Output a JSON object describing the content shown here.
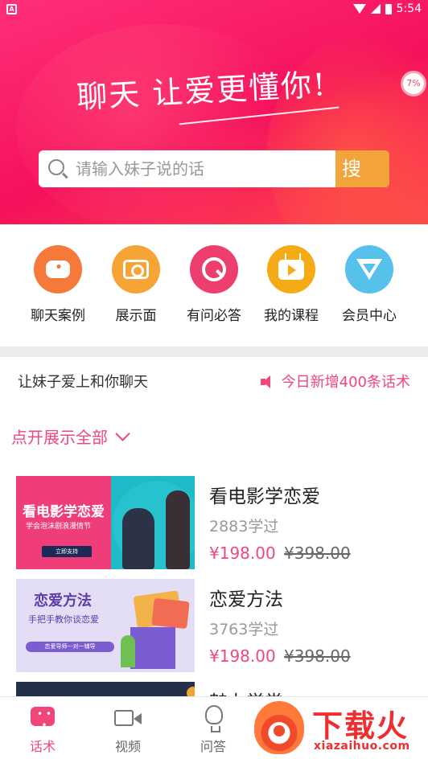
{
  "status_bar": {
    "time": "5:54",
    "app_badge": "A"
  },
  "header": {
    "slogan": "聊天  让爱更懂你!",
    "progress_badge": "7%",
    "search": {
      "placeholder": "请输入妹子说的话",
      "button_label": "搜"
    }
  },
  "colors": {
    "brand_pink": "#f0477a",
    "search_button": "#f2a43a"
  },
  "quick_nav": [
    {
      "label": "聊天案例",
      "icon": "chat-bubble-icon",
      "color": "#f57a39"
    },
    {
      "label": "展示面",
      "icon": "camera-icon",
      "color": "#f6a435"
    },
    {
      "label": "有问必答",
      "icon": "q-search-icon",
      "color": "#ee3e6e"
    },
    {
      "label": "我的课程",
      "icon": "tv-play-icon",
      "color": "#f5ab16"
    },
    {
      "label": "会员中心",
      "icon": "diamond-icon",
      "color": "#56c1ea"
    }
  ],
  "notice": {
    "left": "让妹子爱上和你聊天",
    "right": "今日新增400条话术"
  },
  "expand_label": "点开展示全部",
  "courses": [
    {
      "title": "看电影学恋爱",
      "learned": "2883学过",
      "price": "¥198.00",
      "original_price": "¥398.00",
      "thumb_title": "看电影学恋爱",
      "thumb_subtitle": "学会泡沫剧浪漫情节",
      "thumb_button": "立即支持"
    },
    {
      "title": "恋爱方法",
      "learned": "3763学过",
      "price": "¥198.00",
      "original_price": "¥398.00",
      "thumb_title": "恋爱方法",
      "thumb_subtitle": "手把手教你谈恋爱",
      "thumb_button": "恋爱导师一对一辅导"
    },
    {
      "title": "魅力学堂"
    }
  ],
  "tab_bar": [
    {
      "label": "话术",
      "icon": "chat-icon",
      "active": true
    },
    {
      "label": "视频",
      "icon": "video-icon",
      "active": false
    },
    {
      "label": "问答",
      "icon": "lightbulb-icon",
      "active": false
    }
  ],
  "watermark": {
    "text": "下载火",
    "url": "xiazaihuo.com"
  }
}
